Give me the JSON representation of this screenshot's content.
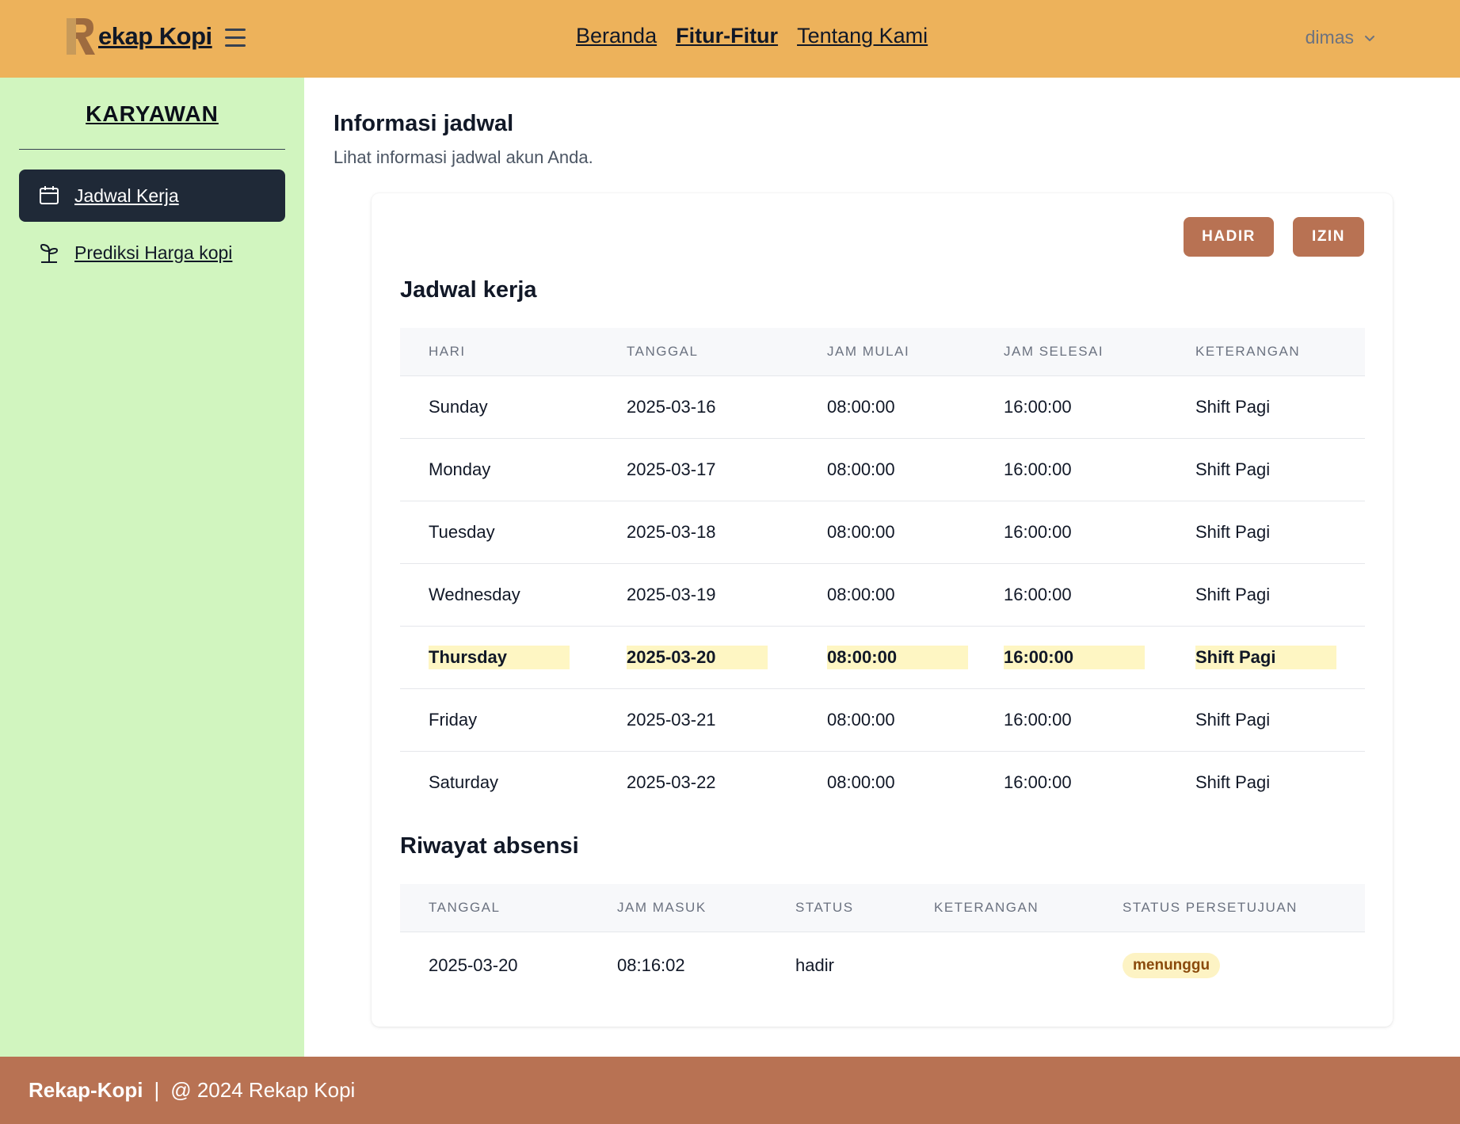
{
  "header": {
    "brand": "ekap Kopi",
    "nav": [
      {
        "label": "Beranda"
      },
      {
        "label": "Fitur-Fitur"
      },
      {
        "label": "Tentang Kami"
      }
    ],
    "user": "dimas",
    "icons": [
      "logo-r-icon",
      "hamburger-menu-icon",
      "chevron-down-icon"
    ]
  },
  "sidebar": {
    "title": "KARYAWAN",
    "items": [
      {
        "label": "Jadwal Kerja",
        "icon": "calendar-icon",
        "active": true
      },
      {
        "label": "Prediksi Harga kopi",
        "icon": "sprout-icon",
        "active": false
      }
    ]
  },
  "main": {
    "title": "Informasi jadwal",
    "subtitle": "Lihat informasi jadwal akun Anda.",
    "buttons": {
      "hadir": "HADIR",
      "izin": "IZIN"
    }
  },
  "schedule": {
    "title": "Jadwal kerja",
    "columns": [
      "HARI",
      "TANGGAL",
      "JAM MULAI",
      "JAM SELESAI",
      "KETERANGAN"
    ],
    "rows": [
      [
        "Sunday",
        "2025-03-16",
        "08:00:00",
        "16:00:00",
        "Shift Pagi"
      ],
      [
        "Monday",
        "2025-03-17",
        "08:00:00",
        "16:00:00",
        "Shift Pagi"
      ],
      [
        "Tuesday",
        "2025-03-18",
        "08:00:00",
        "16:00:00",
        "Shift Pagi"
      ],
      [
        "Wednesday",
        "2025-03-19",
        "08:00:00",
        "16:00:00",
        "Shift Pagi"
      ],
      [
        "Thursday",
        "2025-03-20",
        "08:00:00",
        "16:00:00",
        "Shift Pagi"
      ],
      [
        "Friday",
        "2025-03-21",
        "08:00:00",
        "16:00:00",
        "Shift Pagi"
      ],
      [
        "Saturday",
        "2025-03-22",
        "08:00:00",
        "16:00:00",
        "Shift Pagi"
      ]
    ],
    "highlight_index": 4
  },
  "attendance": {
    "title": "Riwayat absensi",
    "columns": [
      "TANGGAL",
      "JAM MASUK",
      "STATUS",
      "KETERANGAN",
      "STATUS PERSETUJUAN"
    ],
    "rows": [
      [
        "2025-03-20",
        "08:16:02",
        "hadir",
        "",
        "menunggu"
      ]
    ]
  },
  "footer": {
    "brand": "Rekap-Kopi",
    "separator": "|",
    "text": "@ 2024 Rekap Kopi"
  },
  "colors": {
    "header_bg": "#edb25b",
    "sidebar_bg": "#d1f5bf",
    "active_item_bg": "#1f2937",
    "button_bg": "#b87253",
    "footer_bg": "#b87253",
    "highlight_bg": "#fef6c3",
    "badge_bg": "#fdf3c4",
    "badge_text": "#8a4a0c"
  }
}
